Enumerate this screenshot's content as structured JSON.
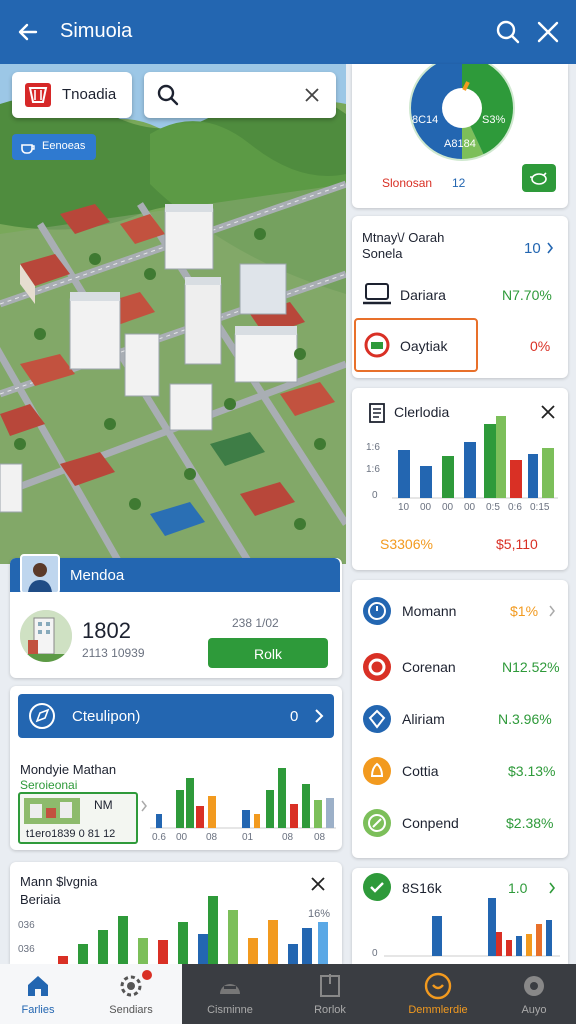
{
  "app": {
    "title": "Simuoia"
  },
  "map_overlay": {
    "badge_label": "Tnoadia",
    "search_placeholder": "",
    "chip_label": "Eenoeas"
  },
  "profile_card": {
    "banner_label": "Mendoa",
    "value": "1802",
    "sub_value": "2113 10939",
    "side_text": "238 1/02",
    "button_label": "Rolk"
  },
  "campaign_card": {
    "banner_label": "Cteulipon)",
    "banner_value": "0",
    "title_line1": "Mondyie Mathan",
    "title_line2": "Seroieonai",
    "thumb_code": "NM",
    "thumb_footer": "t1ero1839 0 81 12",
    "chart_labels": [
      "0.6",
      "00",
      "08",
      "01",
      "08",
      "08"
    ]
  },
  "bottom_left_chart": {
    "title_line1": "Mann $lvgnia",
    "title_line2": "Beriaia",
    "percent_label": "16%",
    "y_labels": [
      "036",
      "036"
    ]
  },
  "donut_card": {
    "left_label": "8C14",
    "right_label": "S3%",
    "bottom_label": "A8184",
    "footer_label": "Slonosan",
    "footer_value": "12",
    "pie_share": 0.5
  },
  "stats_card": {
    "header_line1": "Mtnay\\/ Oarah",
    "header_line2": "Sonela",
    "header_value": "10",
    "rows": [
      {
        "label": "Dariara",
        "value": "N7.70%"
      },
      {
        "label": "Oaytiak",
        "value": "0%"
      }
    ]
  },
  "bar_card": {
    "title": "Clerlodia",
    "y_labels": [
      "1:6",
      "1:6",
      "0"
    ],
    "x_labels": [
      "10",
      "00",
      "00",
      "00",
      "0:5",
      "0:6",
      "0:15"
    ],
    "footer_left": "S3306%",
    "footer_right": "$5,110"
  },
  "list_card": {
    "items": [
      {
        "label": "Momann",
        "value": "$1%",
        "color": "#2366b1"
      },
      {
        "label": "Corenan",
        "value": "N12.52%",
        "color": "#d93025"
      },
      {
        "label": "Aliriam",
        "value": "N.3.96%",
        "color": "#2366b1"
      },
      {
        "label": "Cottia",
        "value": "$3.13%",
        "color": "#f29a1f"
      },
      {
        "label": "Conpend",
        "value": "$2.38%",
        "color": "#7cbf5a"
      }
    ]
  },
  "small_chart_card": {
    "label": "8S16k",
    "value": "1.0",
    "axis_label": "0"
  },
  "bottom_nav": {
    "items": [
      {
        "label": "Farlies",
        "active": true
      },
      {
        "label": "Sendiars",
        "active": false
      },
      {
        "label": "Cisminne",
        "active": false
      },
      {
        "label": "Rorlok",
        "active": false
      },
      {
        "label": "Demmlerdie",
        "active": false
      },
      {
        "label": "Auyo",
        "active": false
      }
    ]
  },
  "colors": {
    "brand_blue": "#2366b1",
    "green": "#2e9a3a",
    "red": "#d93025",
    "orange": "#e8702a",
    "nav_dark": "#3a3d42"
  }
}
